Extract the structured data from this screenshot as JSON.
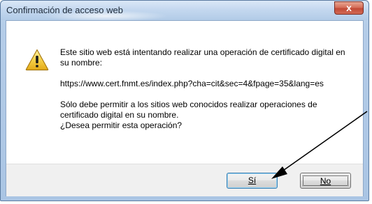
{
  "window": {
    "title": "Confirmación de acceso web",
    "close_symbol": "x"
  },
  "dialog": {
    "icon": "warning-icon",
    "message_line1": "Este sitio web está intentando realizar una operación de certificado digital en su nombre:",
    "url": "https://www.cert.fnmt.es/index.php?cha=cit&sec=4&fpage=35&lang=es",
    "message_line2": "Sólo debe permitir a los sitios web conocidos realizar operaciones de certificado digital en su nombre.",
    "question": "¿Desea permitir esta operación?"
  },
  "buttons": {
    "yes_label": "Sí",
    "no_label": "No"
  },
  "colors": {
    "title_bar": "#c4d8ef",
    "close_button": "#c24a36",
    "footer": "#f0f0f0",
    "annotation_arrow": "#000000"
  }
}
